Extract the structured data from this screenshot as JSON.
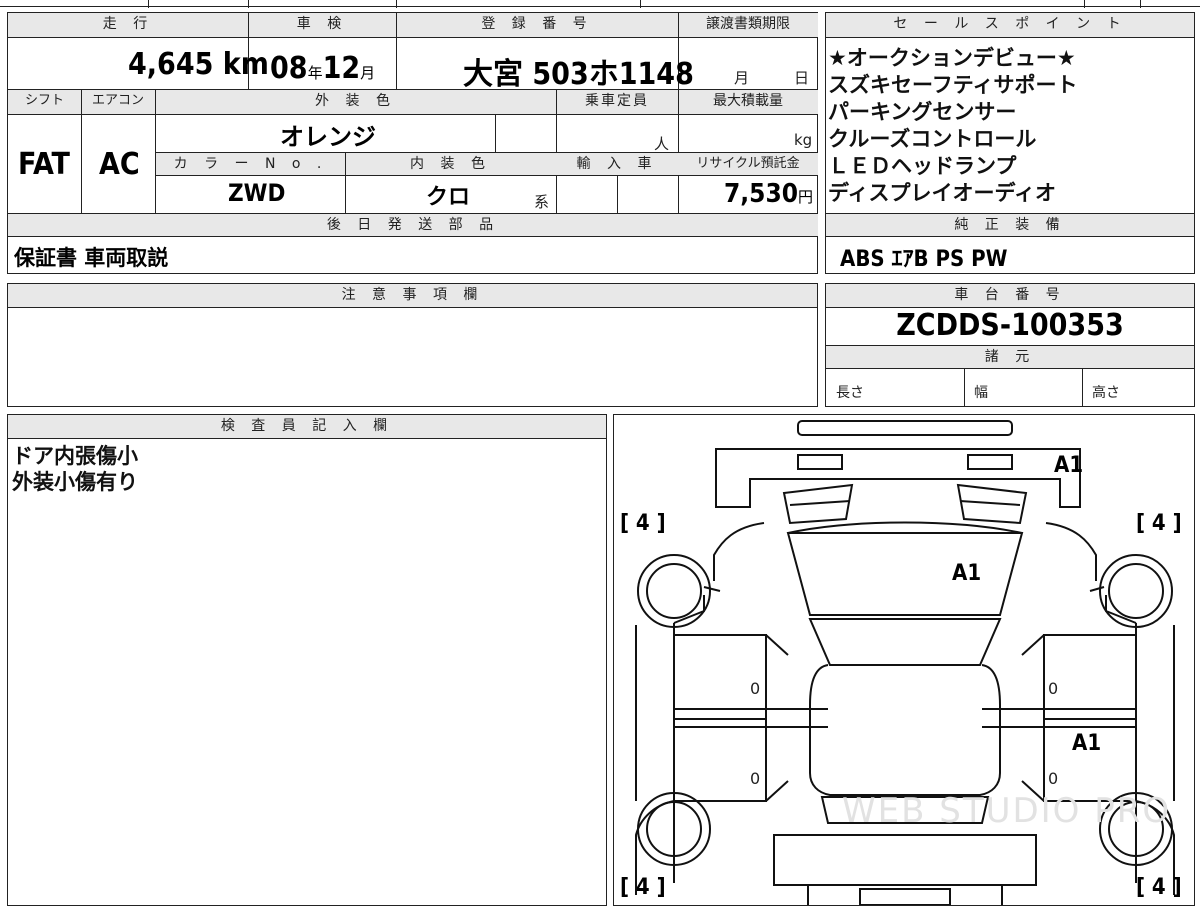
{
  "header": {
    "mileage_label": "走 行",
    "inspection_label": "車 検",
    "registration_label": "登 録 番 号",
    "transfer_doc_label": "譲渡書類期限",
    "shift_label": "シフト",
    "ac_label": "エアコン",
    "exterior_color_label": "外 装 色",
    "capacity_label": "乗車定員",
    "max_load_label": "最大積載量",
    "color_no_label": "カ ラ ー N o .",
    "interior_color_label": "内 装 色",
    "import_label": "輸 入 車",
    "recycle_label": "リサイクル預託金",
    "later_parts_label": "後 日 発 送 部 品"
  },
  "values": {
    "mileage": "4,645",
    "mileage_unit": "km",
    "inspection_year": "08",
    "year_unit": "年",
    "inspection_month": "12",
    "month_unit": "月",
    "registration": "大宮 503ホ1148",
    "doc_month": "月",
    "doc_day": "日",
    "shift": "FAT",
    "ac": "AC",
    "exterior_color": "オレンジ",
    "capacity_unit": "人",
    "load_unit": "kg",
    "color_no": "ZWD",
    "interior_color": "クロ",
    "interior_suffix": "系",
    "recycle_fee": "7,530",
    "recycle_unit": "円",
    "later_parts": "保証書 車両取説"
  },
  "sales_points": {
    "title": "セ ー ル ス ポ イ ン ト",
    "items": [
      "★オークションデビュー★",
      "スズキセーフティサポート",
      "パーキングセンサー",
      "クルーズコントロール",
      "ＬＥＤヘッドランプ",
      "ディスプレイオーディオ"
    ]
  },
  "genuine_equipment": {
    "title": "純 正 装 備",
    "value": "ABS ｴｱB PS PW"
  },
  "notes": {
    "title": "注 意 事 項 欄"
  },
  "chassis": {
    "title": "車 台 番 号",
    "value": "ZCDDS-100353",
    "specs_title": "諸 元",
    "length_label": "長さ",
    "width_label": "幅",
    "height_label": "高さ"
  },
  "inspector": {
    "title": "検 査 員 記 入 欄",
    "lines": [
      "ドア内張傷小",
      "外装小傷有り"
    ]
  },
  "diagram": {
    "tire_marks": [
      "[ 4 ]",
      "[ 4 ]",
      "[ 4 ]",
      "[ 4 ]"
    ],
    "damage_codes": [
      "A1",
      "A1",
      "A1"
    ],
    "zeros": [
      "0",
      "0",
      "0",
      "0"
    ],
    "watermark": "WEB STUDIO PRO"
  }
}
